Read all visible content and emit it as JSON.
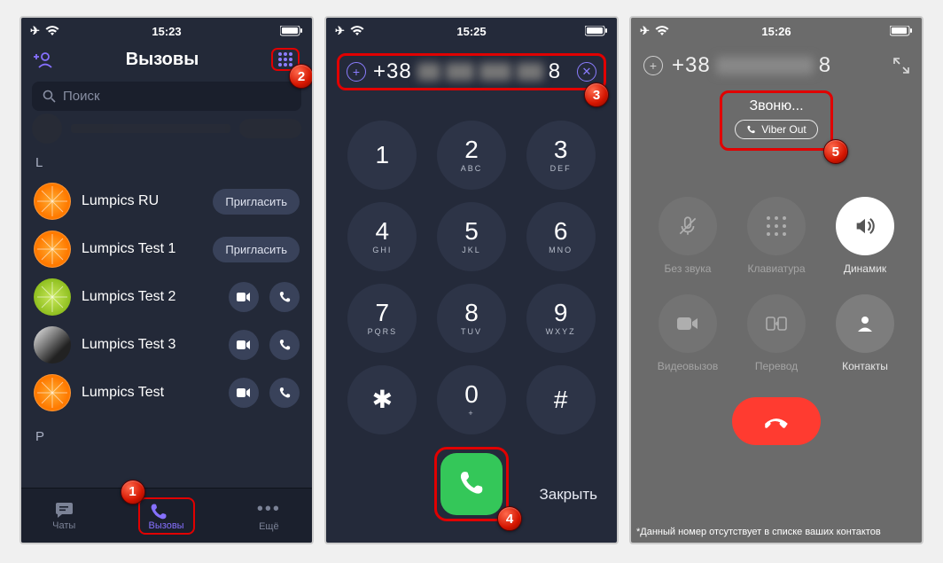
{
  "screen1": {
    "status": {
      "time": "15:23"
    },
    "title": "Вызовы",
    "search_placeholder": "Поиск",
    "section_l": "L",
    "section_p": "P",
    "contacts": [
      {
        "name": "Lumpics RU",
        "action": "invite",
        "invite_label": "Пригласить",
        "avatar": "orange"
      },
      {
        "name": "Lumpics Test 1",
        "action": "invite",
        "invite_label": "Пригласить",
        "avatar": "orange"
      },
      {
        "name": "Lumpics Test 2",
        "action": "call",
        "avatar": "lime"
      },
      {
        "name": "Lumpics Test 3",
        "action": "call",
        "avatar": "photo"
      },
      {
        "name": "Lumpics Test",
        "action": "call",
        "avatar": "orange"
      }
    ],
    "tabs": {
      "chats": "Чаты",
      "calls": "Вызовы",
      "more": "Ещё"
    }
  },
  "screen2": {
    "status": {
      "time": "15:25"
    },
    "number_visible_prefix": "+38",
    "number_visible_tail": "8",
    "keypad": [
      {
        "num": "1",
        "let": ""
      },
      {
        "num": "2",
        "let": "ABC"
      },
      {
        "num": "3",
        "let": "DEF"
      },
      {
        "num": "4",
        "let": "GHI"
      },
      {
        "num": "5",
        "let": "JKL"
      },
      {
        "num": "6",
        "let": "MNO"
      },
      {
        "num": "7",
        "let": "PQRS"
      },
      {
        "num": "8",
        "let": "TUV"
      },
      {
        "num": "9",
        "let": "WXYZ"
      },
      {
        "num": "✱",
        "let": ""
      },
      {
        "num": "0",
        "let": "+"
      },
      {
        "num": "#",
        "let": ""
      }
    ],
    "close": "Закрыть"
  },
  "screen3": {
    "status": {
      "time": "15:26"
    },
    "number_visible_prefix": "+38",
    "number_visible_tail": "8",
    "calling": "Звоню...",
    "viber_out": "Viber Out",
    "controls": {
      "mute": "Без звука",
      "keypad": "Клавиатура",
      "speaker": "Динамик",
      "video": "Видеовызов",
      "transfer": "Перевод",
      "contacts": "Контакты"
    },
    "footer_note": "*Данный номер отсутствует в списке ваших контактов"
  },
  "badges": {
    "b1": "1",
    "b2": "2",
    "b3": "3",
    "b4": "4",
    "b5": "5"
  }
}
